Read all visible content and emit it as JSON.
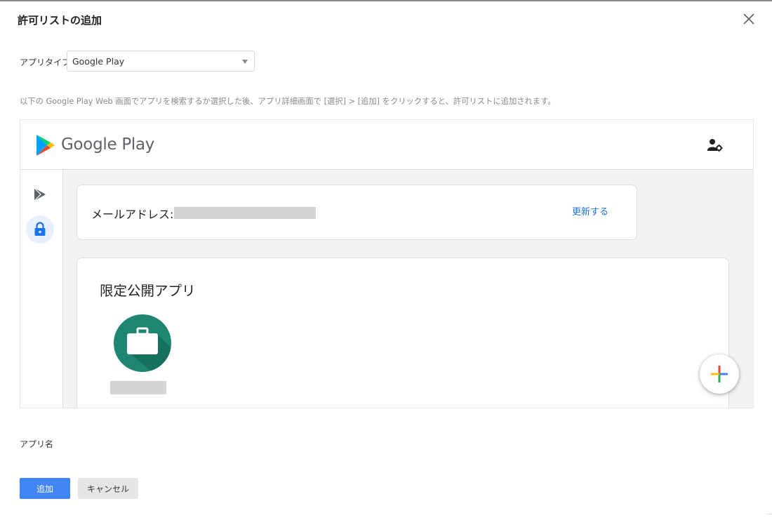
{
  "dialog": {
    "title": "許可リストの追加"
  },
  "form": {
    "app_type_label": "アプリタイプ",
    "app_type_value": "Google Play",
    "instruction": "以下の Google Play Web 画面でアプリを検索するか選択した後、アプリ詳細画面で [選択] > [追加] をクリックすると、許可リストに追加されます。",
    "app_name_label": "アプリ名"
  },
  "google_play": {
    "wordmark": "Google Play",
    "email_label": "メールアドレス:",
    "update_link": "更新する",
    "private_apps_title": "限定公開アプリ",
    "colors": {
      "link": "#1a73e8",
      "app_icon_bg": "#1e8670",
      "nav_active_bg": "#e8f0fe"
    },
    "icons": [
      "play-nav-icon",
      "lock-icon",
      "account-settings-icon",
      "briefcase-icon",
      "plus-icon"
    ]
  },
  "buttons": {
    "add": "追加",
    "cancel": "キャンセル"
  },
  "colors": {
    "primary_button": "#4285f4",
    "secondary_button": "#e6e6e6"
  }
}
